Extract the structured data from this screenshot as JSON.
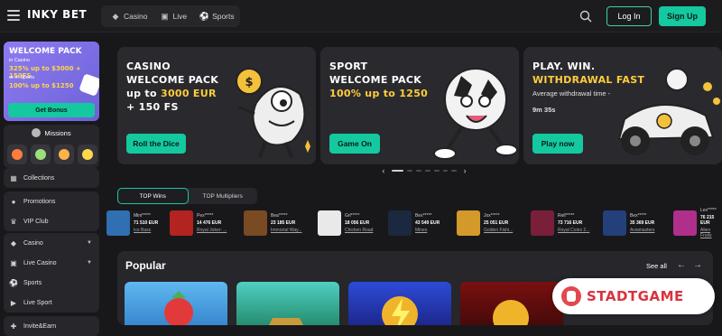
{
  "header": {
    "logo_text": "INKY BET",
    "nav": [
      {
        "label": "Casino",
        "icon": "casino-icon"
      },
      {
        "label": "Live",
        "icon": "live-icon"
      },
      {
        "label": "Sports",
        "icon": "sports-icon"
      }
    ],
    "login_label": "Log In",
    "signup_label": "Sign Up"
  },
  "sidebar": {
    "promo": {
      "title": "WELCOME PACK",
      "casino_line": "in Casino",
      "casino_offer": "325% up to $3000 + 150FS",
      "sports_line": "or in Sports",
      "sports_offer": "100% up to $1250",
      "cta": "Get Bonus"
    },
    "missions_label": "Missions",
    "group1": [
      {
        "label": "Collections",
        "icon": "collections-icon"
      },
      {
        "label": "Promotions",
        "icon": "promotions-icon"
      },
      {
        "label": "VIP Club",
        "icon": "crown-icon"
      }
    ],
    "group2": [
      {
        "label": "Casino",
        "icon": "casino-icon"
      },
      {
        "label": "Live Casino",
        "icon": "live-casino-icon"
      },
      {
        "label": "Sports",
        "icon": "sports-icon"
      },
      {
        "label": "Live Sport",
        "icon": "live-sport-icon"
      }
    ],
    "group3": [
      {
        "label": "Invite&Earn",
        "icon": "invite-icon"
      }
    ]
  },
  "banners": [
    {
      "line1": "CASINO",
      "line2": "WELCOME PACK",
      "line3_pre": "up to ",
      "line3_hi": "3000 EUR",
      "line4": "+ 150 FS",
      "cta": "Roll the Dice"
    },
    {
      "line1": "SPORT",
      "line2": "WELCOME PACK",
      "line3_hi": "100% up to 1250",
      "cta": "Game On"
    },
    {
      "line1": "PLAY. WIN.",
      "line2": "WITHDRAWAL FAST",
      "sub1": "Average withdrawal time -",
      "sub2": "9m 35s",
      "cta": "Play now"
    }
  ],
  "tabs": {
    "top_wins": "TOP Wins",
    "top_multipliers": "TOP Multipliers"
  },
  "wins": [
    {
      "user": "Mini*****",
      "amount": "71 510 EUR",
      "game": "Ice Bass",
      "color": "#2f6fb2"
    },
    {
      "user": "Pex*****",
      "amount": "14 476 EUR",
      "game": "Royal Joker: ...",
      "color": "#b3231f"
    },
    {
      "user": "Bea*****",
      "amount": "23 185 EUR",
      "game": "Immortal Way...",
      "color": "#7a4a22"
    },
    {
      "user": "Grl*****",
      "amount": "18 056 EUR",
      "game": "Chicken Road",
      "color": "#e9e9e9"
    },
    {
      "user": "Bex*****",
      "amount": "43 549 EUR",
      "game": "Mines",
      "color": "#1a2840"
    },
    {
      "user": "Jox*****",
      "amount": "25 051 EUR",
      "game": "Golden Fishi...",
      "color": "#d39a2a"
    },
    {
      "user": "Rell*****",
      "amount": "73 716 EUR",
      "game": "Royal Coins 2...",
      "color": "#7a1f3a"
    },
    {
      "user": "Bex*****",
      "amount": "35 369 EUR",
      "game": "Aviamasters",
      "color": "#24407a"
    },
    {
      "user": "Lex*****",
      "amount": "76 215 EUR",
      "game": "Alien Fruits",
      "color": "#b02f8a"
    }
  ],
  "popular": {
    "title": "Popular",
    "see_all": "See all"
  },
  "watermark": "STADTGAME",
  "colors": {
    "accent": "#14c9a0",
    "highlight": "#ffce3a",
    "promo": "#8e7bf0"
  }
}
